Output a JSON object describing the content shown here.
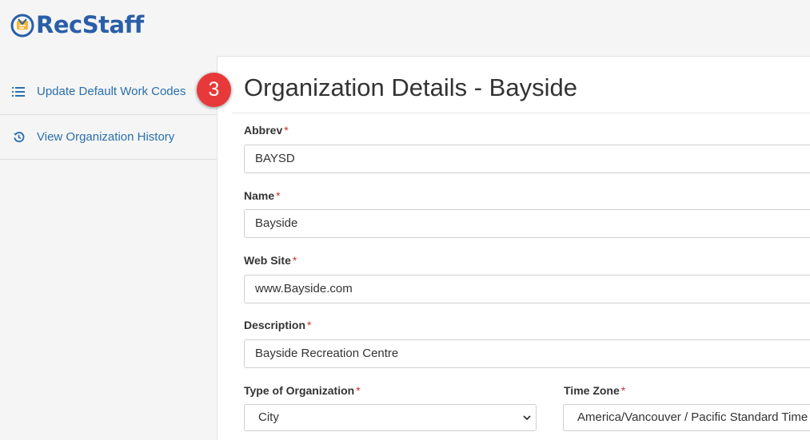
{
  "app": {
    "logo_text": "RecStaff"
  },
  "sidebar": {
    "items": [
      {
        "label": "Update Default Work Codes",
        "icon": "list-numbered-icon"
      },
      {
        "label": "View Organization History",
        "icon": "history-icon"
      }
    ]
  },
  "annotation": {
    "step_number": "3"
  },
  "page": {
    "title": "Organization Details - Bayside"
  },
  "form": {
    "required_marker": "*",
    "abbrev": {
      "label": "Abbrev",
      "value": "BAYSD"
    },
    "name": {
      "label": "Name",
      "value": "Bayside"
    },
    "website": {
      "label": "Web Site",
      "value": "www.Bayside.com"
    },
    "description": {
      "label": "Description",
      "value": "Bayside Recreation Centre"
    },
    "org_type": {
      "label": "Type of Organization",
      "value": "City"
    },
    "time_zone": {
      "label": "Time Zone",
      "value": "America/Vancouver / Pacific Standard Time"
    }
  },
  "colors": {
    "brand": "#2a5fa8",
    "link": "#2a6fad",
    "badge": "#e8393a",
    "required": "#c9302c"
  }
}
